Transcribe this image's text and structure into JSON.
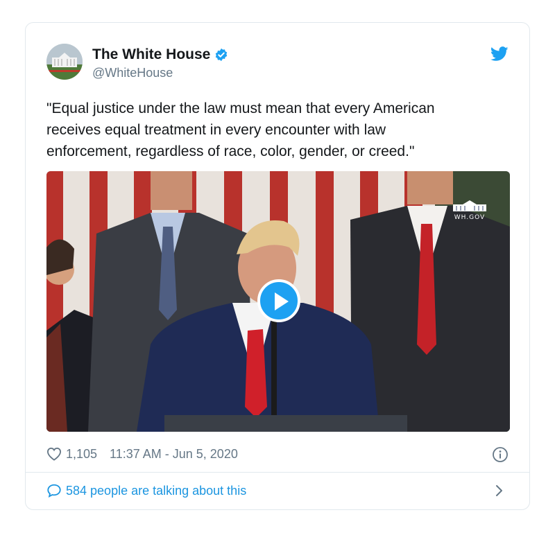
{
  "tweet": {
    "display_name": "The White House",
    "handle": "@WhiteHouse",
    "text": "\"Equal justice under the law must mean that every American\nreceives equal treatment in every encounter with law\nenforcement, regardless of race, color, gender, or creed.\"",
    "media": {
      "watermark": "WH.GOV"
    },
    "likes": "1,105",
    "timestamp": "11:37 AM - Jun 5, 2020",
    "conversation_label": "584 people are talking about this"
  },
  "colors": {
    "accent": "#1da1f2",
    "link": "#1b95e0",
    "muted": "#657786",
    "border": "#e1e8ed"
  },
  "icons": {
    "brand": "twitter-bird-icon",
    "verified": "verified-badge-icon",
    "like": "heart-icon",
    "info": "info-icon",
    "conversation": "speech-bubble-icon",
    "more": "chevron-right-icon",
    "play": "play-icon"
  }
}
